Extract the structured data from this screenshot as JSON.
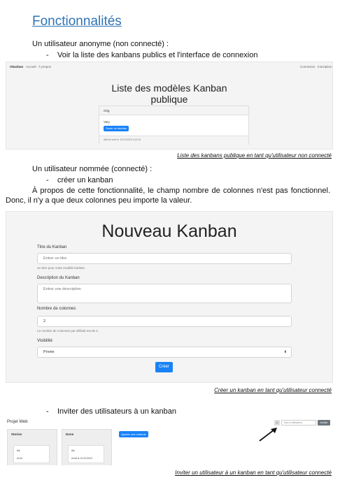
{
  "heading": "Fonctionnalités",
  "anon": {
    "intro": "Un utilisateur anonyme (non connecté) :",
    "bullet": "Voir la liste des kanbans publics et l'interface de connexion"
  },
  "shot1": {
    "brand": "Okanban",
    "nav_home": "Accueil",
    "nav_about": "À propos",
    "nav_login": "Connexion",
    "nav_signup": "Inscription",
    "title_line1": "Liste des modèles Kanban",
    "title_line2": "publique",
    "card_header": "Orig",
    "card_body": "Vary",
    "card_button": "Ouvrir ce kanban",
    "card_footer": "Affiché créé le 10/12/2022 à 00:15"
  },
  "caption1": "Liste des kanbans publique en tant qu'utilisateur non connecté",
  "named": {
    "intro": "Un utilisateur nommée (connecté) :",
    "bullet": "créer un kanban",
    "para": "À propos de cette fonctionnalité, le champ nombre de colonnes n'est pas fonctionnel. Donc, il n'y a que deux  colonnes peu importe la valeur."
  },
  "shot2": {
    "title": "Nouveau Kanban",
    "name_label": "Titre du Kanban",
    "name_placeholder": "Entrer un titre",
    "name_help": "Un titre pour votre modèle kanban",
    "desc_label": "Description du Kanban",
    "desc_placeholder": "Entrer une description",
    "cols_label": "Nombre de colonnes",
    "cols_value": "2",
    "cols_help": "Le nombre de colonnes par défault est de 2.",
    "vis_label": "Visibilité",
    "vis_value": "Privée",
    "submit": "Créer"
  },
  "caption2": "Créer un kanban en tant qu'utilisateur connecté",
  "invite": {
    "bullet": "Inviter des utilisateurs à un kanban"
  },
  "shot3": {
    "project": "Projet Web",
    "invite_placeholder": "Nom d'utilisateur",
    "invite_button": "Inviter",
    "col1_title": "Stories",
    "col1_card1": "As",
    "col1_card2": "Arold",
    "col2_title": "Done",
    "col2_card1": "As",
    "col2_card_date": "Avatt le 22/12/2022",
    "add_column": "Ajouter une colonne"
  },
  "caption3": "Inviter un utilisateur à un kanban en tant qu'utilisateur connecté"
}
